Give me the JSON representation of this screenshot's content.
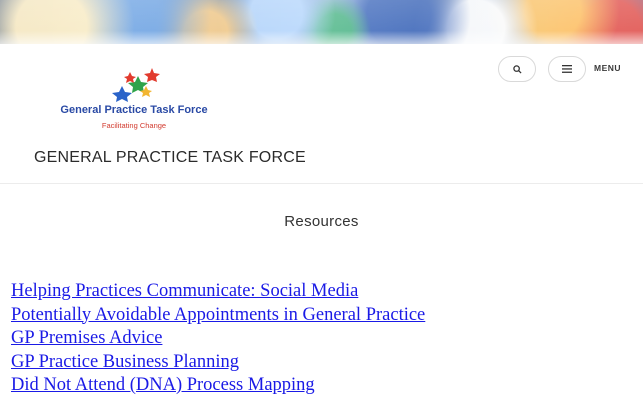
{
  "header": {
    "logo": {
      "name": "General Practice Task Force",
      "tagline": "Facilitating Change",
      "colors": {
        "name": "#2a4aa5",
        "tagline": "#d23a2e",
        "star_red": "#e23b2e",
        "star_green": "#2fa34a",
        "star_blue": "#2a63c9",
        "star_yellow": "#f2b531"
      }
    },
    "site_title": "GENERAL PRACTICE TASK FORCE",
    "search": {
      "icon": "search-icon"
    },
    "menu": {
      "icon": "hamburger-icon",
      "label": "MENU"
    }
  },
  "main": {
    "title": "Resources",
    "resources": [
      {
        "label": "Helping Practices Communicate: Social Media"
      },
      {
        "label": "Potentially Avoidable Appointments in General Practice"
      },
      {
        "label": "GP Premises Advice"
      },
      {
        "label": "GP Practice Business Planning"
      },
      {
        "label": "Did Not Attend (DNA) Process Mapping"
      }
    ],
    "link_color": "#1a1ae6"
  }
}
